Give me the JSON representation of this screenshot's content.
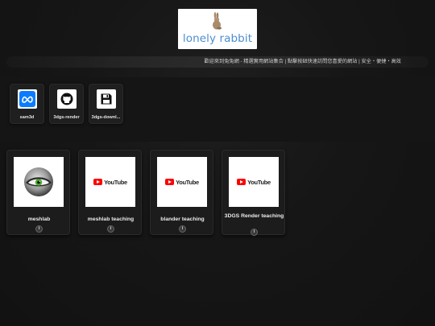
{
  "header": {
    "logo_text": "lonely rabbit",
    "logo_icon": "rabbit-icon"
  },
  "ticker": {
    "text": "歡迎來到兔兔網 - 精選實用網站集合 | 點擊按鈕快速訪問您喜愛的網站 | 安全・便捷・高效"
  },
  "shortcuts": [
    {
      "label": "sam3d",
      "icon": "meta-icon",
      "color": "#0a7cff"
    },
    {
      "label": "3dgs-render",
      "icon": "github-icon",
      "color": "#111111"
    },
    {
      "label": "3dgs-downl...",
      "icon": "floppy-disk-icon",
      "color": "#111111"
    }
  ],
  "cards": [
    {
      "label": "meshlab",
      "icon": "meshlab-eye-icon",
      "info": "i"
    },
    {
      "label": "meshlab teaching",
      "icon": "youtube-logo",
      "info": "i"
    },
    {
      "label": "blander teaching",
      "icon": "youtube-logo",
      "info": "i"
    },
    {
      "label": "3DGS Render teaching",
      "icon": "youtube-logo",
      "info": "i"
    }
  ],
  "youtube_word": "YouTube",
  "colors": {
    "background": "#161616",
    "logo_text": "#4b8ed0",
    "youtube_red": "#ff0000"
  }
}
